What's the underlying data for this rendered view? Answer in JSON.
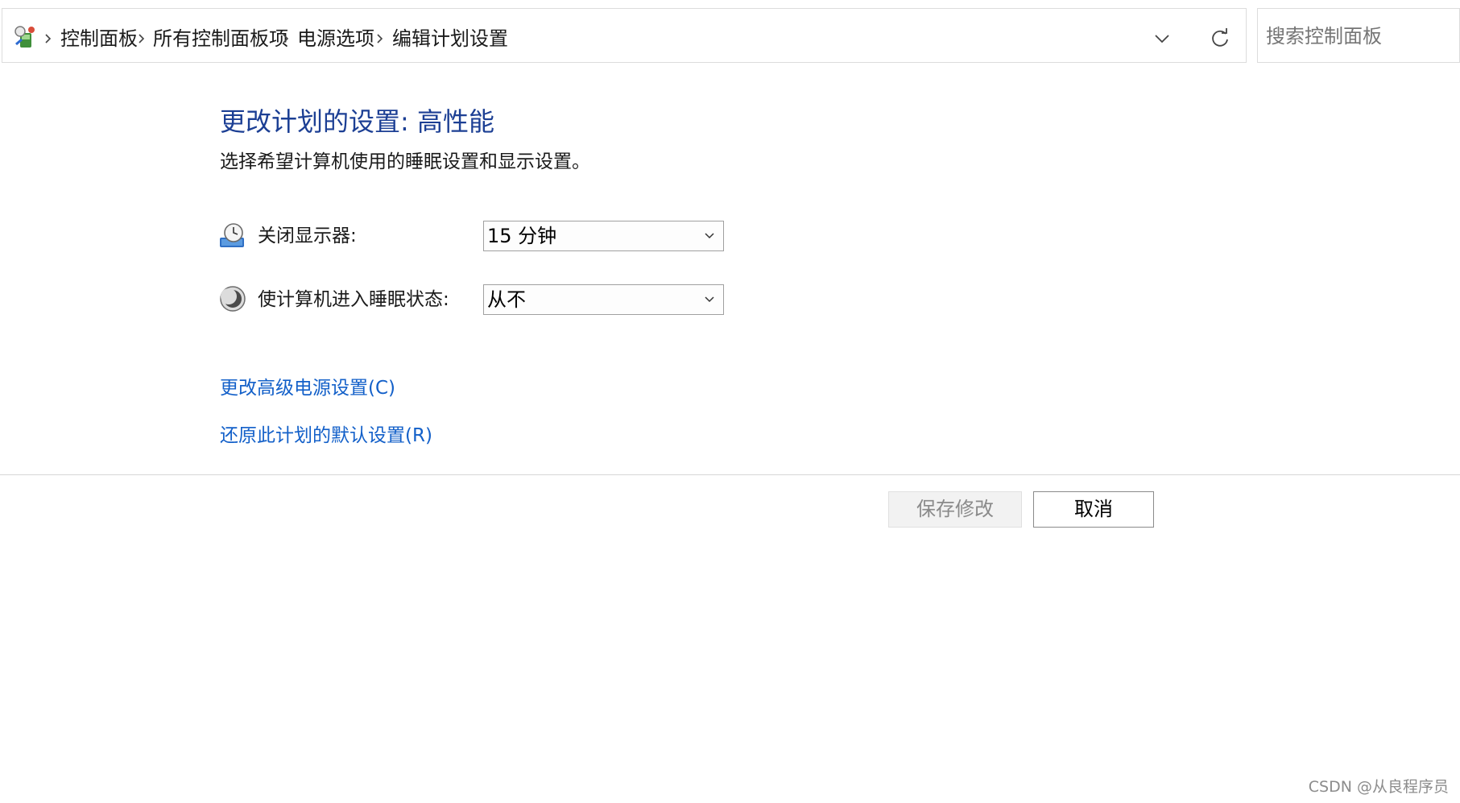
{
  "addressbar": {
    "crumbs": [
      "控制面板",
      "所有控制面板项",
      "电源选项",
      "编辑计划设置"
    ]
  },
  "search": {
    "placeholder": "搜索控制面板"
  },
  "main": {
    "title": "更改计划的设置: 高性能",
    "subtitle": "选择希望计算机使用的睡眠设置和显示设置。",
    "settings": [
      {
        "label": "关闭显示器:",
        "value": "15 分钟",
        "icon": "display-clock-icon"
      },
      {
        "label": "使计算机进入睡眠状态:",
        "value": "从不",
        "icon": "sleep-moon-icon"
      }
    ],
    "links": {
      "advanced": "更改高级电源设置(C)",
      "restore": "还原此计划的默认设置(R)"
    }
  },
  "footer": {
    "save_label": "保存修改",
    "cancel_label": "取消"
  },
  "watermark": "CSDN @从良程序员",
  "colors": {
    "title": "#1c3f94",
    "link": "#1360c9",
    "disabled_text": "#8a8a8a"
  }
}
